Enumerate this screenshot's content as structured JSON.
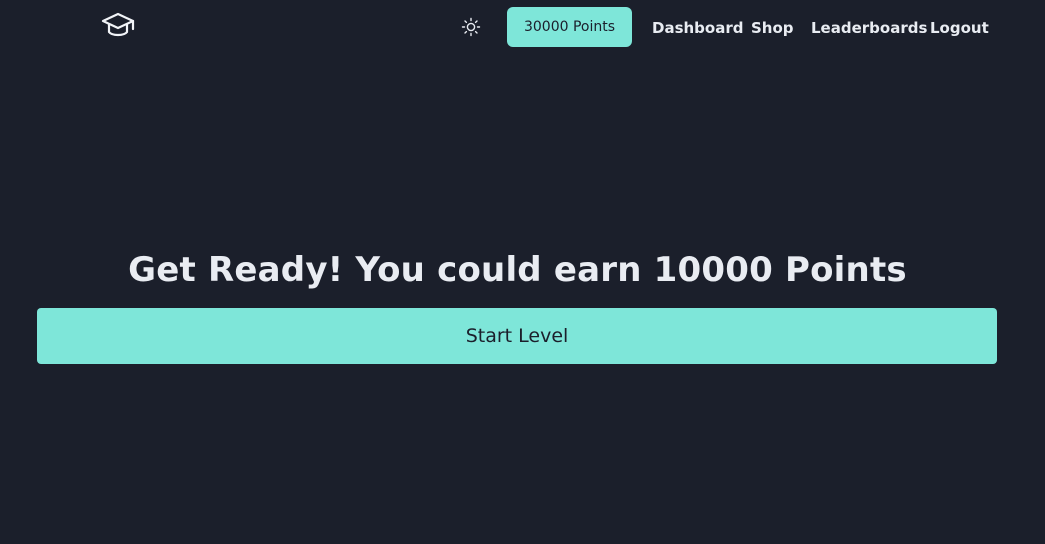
{
  "colors": {
    "background": "#1b1f2b",
    "accent": "#7ee6d9",
    "text": "#e9ecf2"
  },
  "navbar": {
    "logo_icon": "graduation-cap-icon",
    "theme_icon": "sun-icon",
    "points_label": "30000 Points",
    "links": {
      "dashboard": "Dashboard",
      "shop": "Shop",
      "leaderboards": "Leaderboards",
      "logout": "Logout"
    }
  },
  "main": {
    "headline": "Get Ready! You could earn 10000 Points",
    "start_label": "Start Level"
  }
}
